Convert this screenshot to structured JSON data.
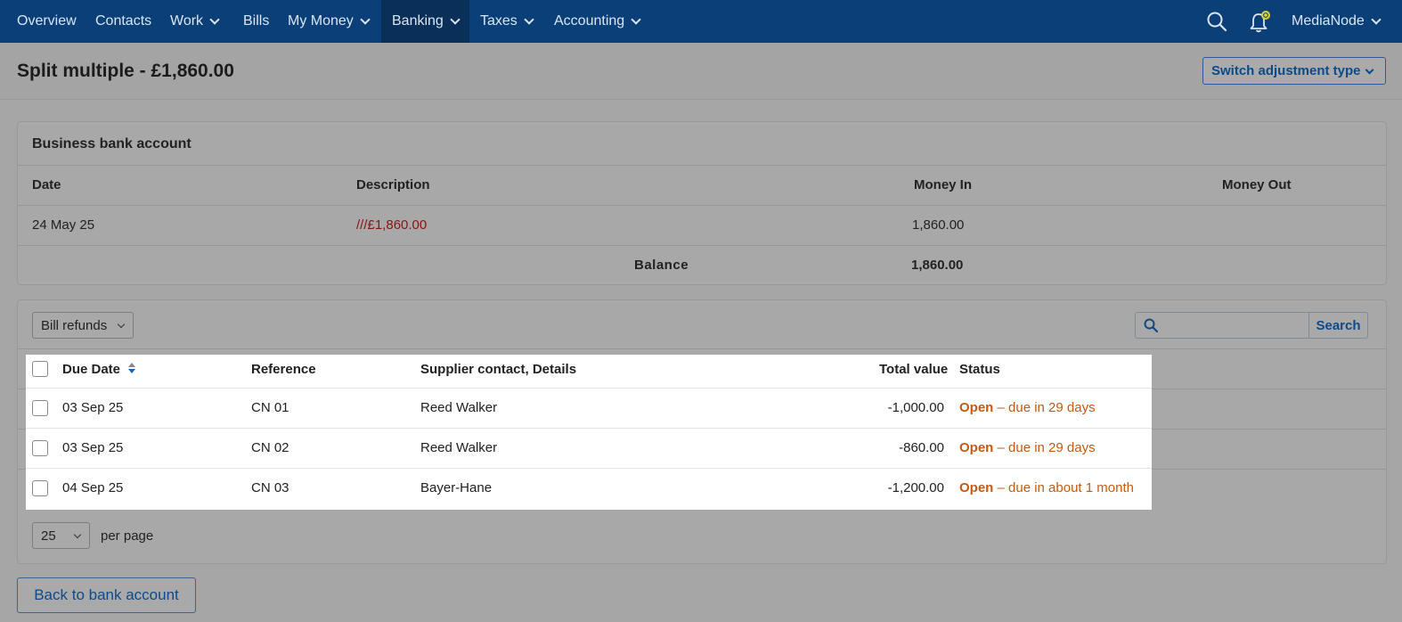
{
  "nav": {
    "items": [
      {
        "label": "Overview",
        "has_menu": false
      },
      {
        "label": "Contacts",
        "has_menu": false
      },
      {
        "label": "Work",
        "has_menu": true
      },
      {
        "label": "Bills",
        "has_menu": false
      },
      {
        "label": "My Money",
        "has_menu": true
      },
      {
        "label": "Banking",
        "has_menu": true,
        "active": true
      },
      {
        "label": "Taxes",
        "has_menu": true
      },
      {
        "label": "Accounting",
        "has_menu": true
      }
    ],
    "account_name": "MediaNode"
  },
  "header": {
    "title": "Split multiple - £1,860.00",
    "switch_button": "Switch adjustment type"
  },
  "bank_card": {
    "title": "Business bank account",
    "columns": {
      "date": "Date",
      "description": "Description",
      "money_in": "Money In",
      "money_out": "Money Out"
    },
    "row": {
      "date": "24 May 25",
      "description": "///£1,860.00",
      "money_in": "1,860.00",
      "money_out": ""
    },
    "balance_label": "Balance",
    "balance_value": "1,860.00"
  },
  "allocation": {
    "filter_select": "Bill refunds",
    "search_placeholder": "",
    "search_button": "Search",
    "columns": {
      "due_date": "Due Date",
      "reference": "Reference",
      "supplier": "Supplier contact, Details",
      "total": "Total value",
      "status": "Status"
    },
    "rows": [
      {
        "due_date": "03 Sep 25",
        "reference": "CN 01",
        "supplier": "Reed Walker",
        "total": "-1,000.00",
        "status": "Open",
        "status_detail": " – due in 29 days"
      },
      {
        "due_date": "03 Sep 25",
        "reference": "CN 02",
        "supplier": "Reed Walker",
        "total": "-860.00",
        "status": "Open",
        "status_detail": " – due in 29 days"
      },
      {
        "due_date": "04 Sep 25",
        "reference": "CN 03",
        "supplier": "Bayer-Hane",
        "total": "-1,200.00",
        "status": "Open",
        "status_detail": " – due in about 1 month"
      }
    ],
    "per_page_value": "25",
    "per_page_label": "per page"
  },
  "back_button": "Back to bank account",
  "colors": {
    "nav_bg": "#0b3f78",
    "link_blue": "#0e4a8a",
    "status_orange": "#c55a11",
    "desc_red": "#8a1414"
  }
}
